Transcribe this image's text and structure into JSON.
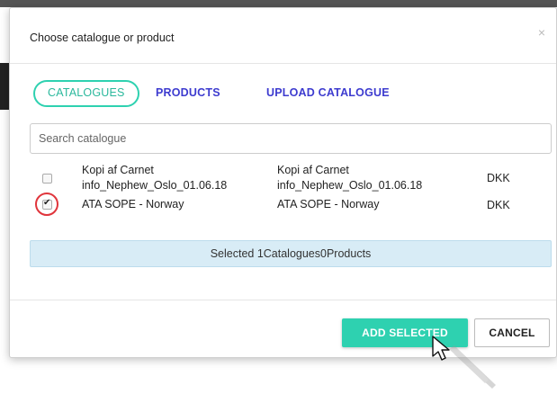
{
  "dialog": {
    "title": "Choose catalogue or product",
    "close_label": "×"
  },
  "tabs": [
    {
      "label": "CATALOGUES",
      "active": true
    },
    {
      "label": "PRODUCTS",
      "active": false
    },
    {
      "label": "UPLOAD CATALOGUE",
      "active": false
    }
  ],
  "search": {
    "placeholder": "Search catalogue",
    "value": ""
  },
  "catalogues": [
    {
      "checked": false,
      "name": [
        "Kopi af Carnet",
        "info_Nephew_Oslo_01.06.18"
      ],
      "description": [
        "Kopi af Carnet",
        "info_Nephew_Oslo_01.06.18"
      ],
      "currency": "DKK"
    },
    {
      "checked": true,
      "name": [
        "ATA SOPE - Norway"
      ],
      "description": [
        "ATA SOPE - Norway"
      ],
      "currency": "DKK"
    }
  ],
  "selection_summary": "Selected 1Catalogues0Products",
  "footer": {
    "add_label": "ADD SELECTED",
    "cancel_label": "CANCEL"
  },
  "colors": {
    "accent": "#2ed1b0",
    "tab_text": "#3d3bcf",
    "highlight_ring": "#e0353c",
    "summary_bg": "#d8ecf6"
  }
}
